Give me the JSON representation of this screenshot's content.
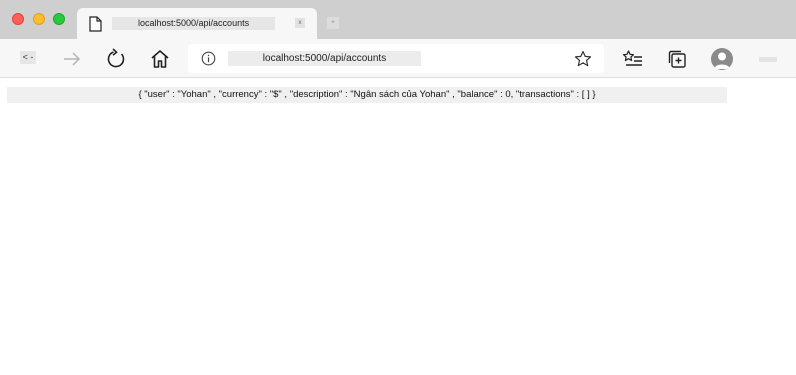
{
  "tab": {
    "title": "localhost:5000/api/accounts",
    "close_glyph": "x",
    "new_tab_glyph": "+"
  },
  "toolbar": {
    "back_label": "< -",
    "address_url": "localhost:5000/api/accounts"
  },
  "content": {
    "json_text": "{ \"user\" : \"Yohan\" , \"currency\" : \"$\" , \"description\" : \"Ngân sách của Yohan\" , \"balance\" : 0, \"transactions\" : [ ] }"
  },
  "icons": {
    "tab": "page-icon",
    "back": "back-arrow-icon",
    "forward": "forward-arrow-icon",
    "refresh": "refresh-icon",
    "home": "home-icon",
    "info": "info-icon",
    "favorite": "star-icon",
    "favorites_list": "favorites-list-icon",
    "collections": "collections-icon",
    "profile": "avatar-icon"
  },
  "colors": {
    "traffic_red": "#fe5f57",
    "traffic_yellow": "#febc2e",
    "traffic_green": "#28c840",
    "tabstrip": "#cfcfcf",
    "toolbar": "#f7f7f7"
  }
}
